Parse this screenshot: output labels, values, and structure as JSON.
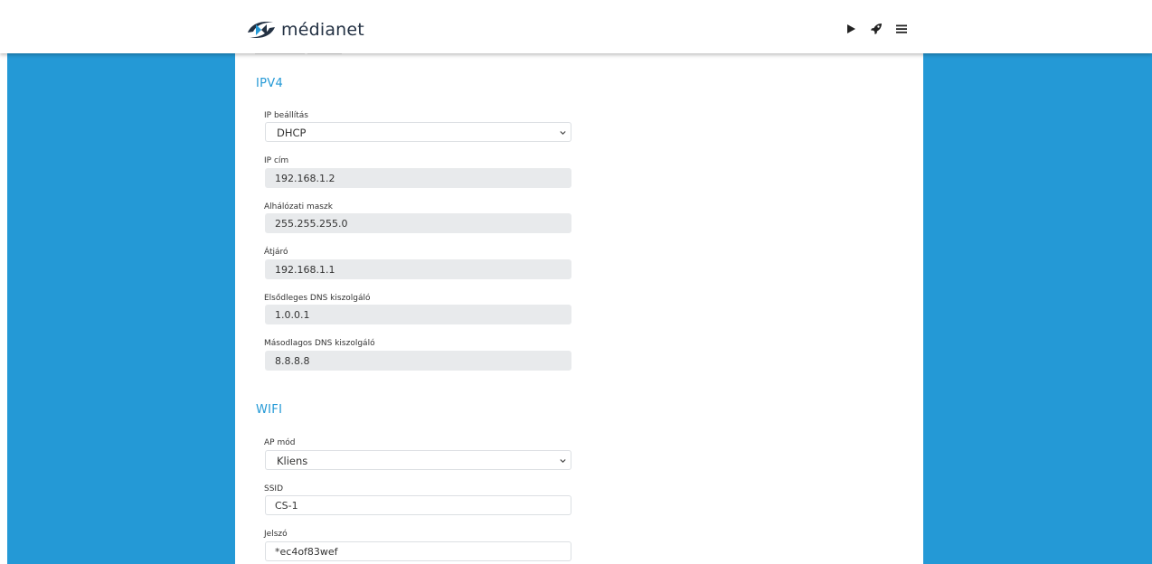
{
  "brand": {
    "name": "médianet",
    "color": "#233143",
    "accent": "#2499d6"
  },
  "nav": {
    "icons": [
      "play-icon",
      "rocket-icon",
      "menu-icon"
    ]
  },
  "ipv4": {
    "title": "IPV4",
    "ip_setting": {
      "label": "IP beállítás",
      "value": "DHCP"
    },
    "ip_address": {
      "label": "IP cím",
      "value": "192.168.1.2"
    },
    "subnet_mask": {
      "label": "Alhálózati maszk",
      "value": "255.255.255.0"
    },
    "gateway": {
      "label": "Átjáró",
      "value": "192.168.1.1"
    },
    "primary_dns": {
      "label": "Elsődleges DNS kiszolgáló",
      "value": "1.0.0.1"
    },
    "secondary_dns": {
      "label": "Másodlagos DNS kiszolgáló",
      "value": "8.8.8.8"
    }
  },
  "wifi": {
    "title": "WIFI",
    "ap_mode": {
      "label": "AP mód",
      "value": "Kliens"
    },
    "ssid": {
      "label": "SSID",
      "value": "CS-1"
    },
    "password": {
      "label": "Jelszó",
      "value": "*ec4of83wef"
    }
  }
}
